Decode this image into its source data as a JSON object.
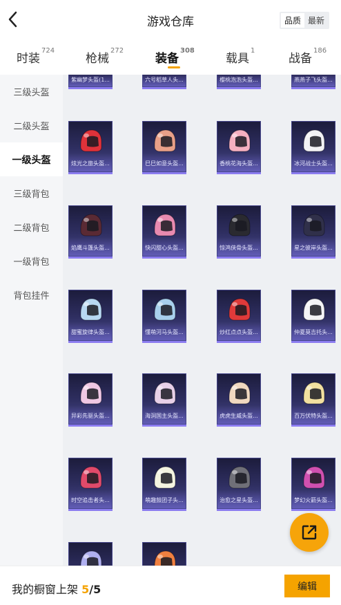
{
  "header": {
    "title": "游戏仓库",
    "back_icon": "chevron-left-icon",
    "sort_options": [
      {
        "label": "品质",
        "active": true
      },
      {
        "label": "最新",
        "active": false
      }
    ]
  },
  "tabs": [
    {
      "label": "时装",
      "count": "724",
      "active": false
    },
    {
      "label": "枪械",
      "count": "272",
      "active": false
    },
    {
      "label": "装备",
      "count": "308",
      "active": true
    },
    {
      "label": "载具",
      "count": "1",
      "active": false
    },
    {
      "label": "战备",
      "count": "186",
      "active": false
    }
  ],
  "sidebar": {
    "items": [
      {
        "label": "三级头盔",
        "active": false
      },
      {
        "label": "二级头盔",
        "active": false
      },
      {
        "label": "一级头盔",
        "active": true
      },
      {
        "label": "三级背包",
        "active": false
      },
      {
        "label": "二级背包",
        "active": false
      },
      {
        "label": "一级背包",
        "active": false
      },
      {
        "label": "背包挂件",
        "active": false
      }
    ]
  },
  "grid": {
    "items": [
      {
        "label": "紫幽梦头盔(1...",
        "color": "#9a7ad8"
      },
      {
        "label": "六号稻草人头...",
        "color": "#c8a070"
      },
      {
        "label": "樱桃泡泡头盔...",
        "color": "#f27aa0"
      },
      {
        "label": "燕燕子飞头盔...",
        "color": "#e0e0e8"
      },
      {
        "label": "炫光之旅头盔...",
        "color": "#e0323a"
      },
      {
        "label": "巳巳如意头盔...",
        "color": "#e8a088"
      },
      {
        "label": "香桃花海头盔...",
        "color": "#f5b0c0"
      },
      {
        "label": "冰河战士头盔...",
        "color": "#f2f2f5"
      },
      {
        "label": "焰鹰斗篷头盔...",
        "color": "#5a2a34"
      },
      {
        "label": "快闪甜心头盔...",
        "color": "#e88ab0"
      },
      {
        "label": "惊鸿侠骨头盔...",
        "color": "#2a2a30"
      },
      {
        "label": "星之彼岸头盔...",
        "color": "#30304a"
      },
      {
        "label": "甜蜜旋律头盔...",
        "color": "#b8d8f2"
      },
      {
        "label": "懂萌河马头盔...",
        "color": "#a8d0ec"
      },
      {
        "label": "炒红点点头盔...",
        "color": "#e03a3a"
      },
      {
        "label": "仲夏莫吉托头...",
        "color": "#f4f4f6"
      },
      {
        "label": "异彩先驱头盔...",
        "color": "#f0c8e4"
      },
      {
        "label": "海洞国主头盔...",
        "color": "#e8d0e8"
      },
      {
        "label": "虎虎生威头盔...",
        "color": "#f0d8c0"
      },
      {
        "label": "百万伏特头盔...",
        "color": "#f2e0a0"
      },
      {
        "label": "时空追击者头...",
        "color": "#e04a6a"
      },
      {
        "label": "萌趣鼓团子头...",
        "color": "#f4f4e0"
      },
      {
        "label": "治愈之星头盔...",
        "color": "#707078"
      },
      {
        "label": "梦幻火箭头盔...",
        "color": "#d050b0"
      },
      {
        "label": "",
        "color": "#b0b0f0"
      },
      {
        "label": "",
        "color": "#f08040"
      }
    ]
  },
  "fab": {
    "icon": "share-icon"
  },
  "footer": {
    "label": "我的橱窗上架",
    "count": "5",
    "total": "/5",
    "edit_label": "编辑"
  }
}
